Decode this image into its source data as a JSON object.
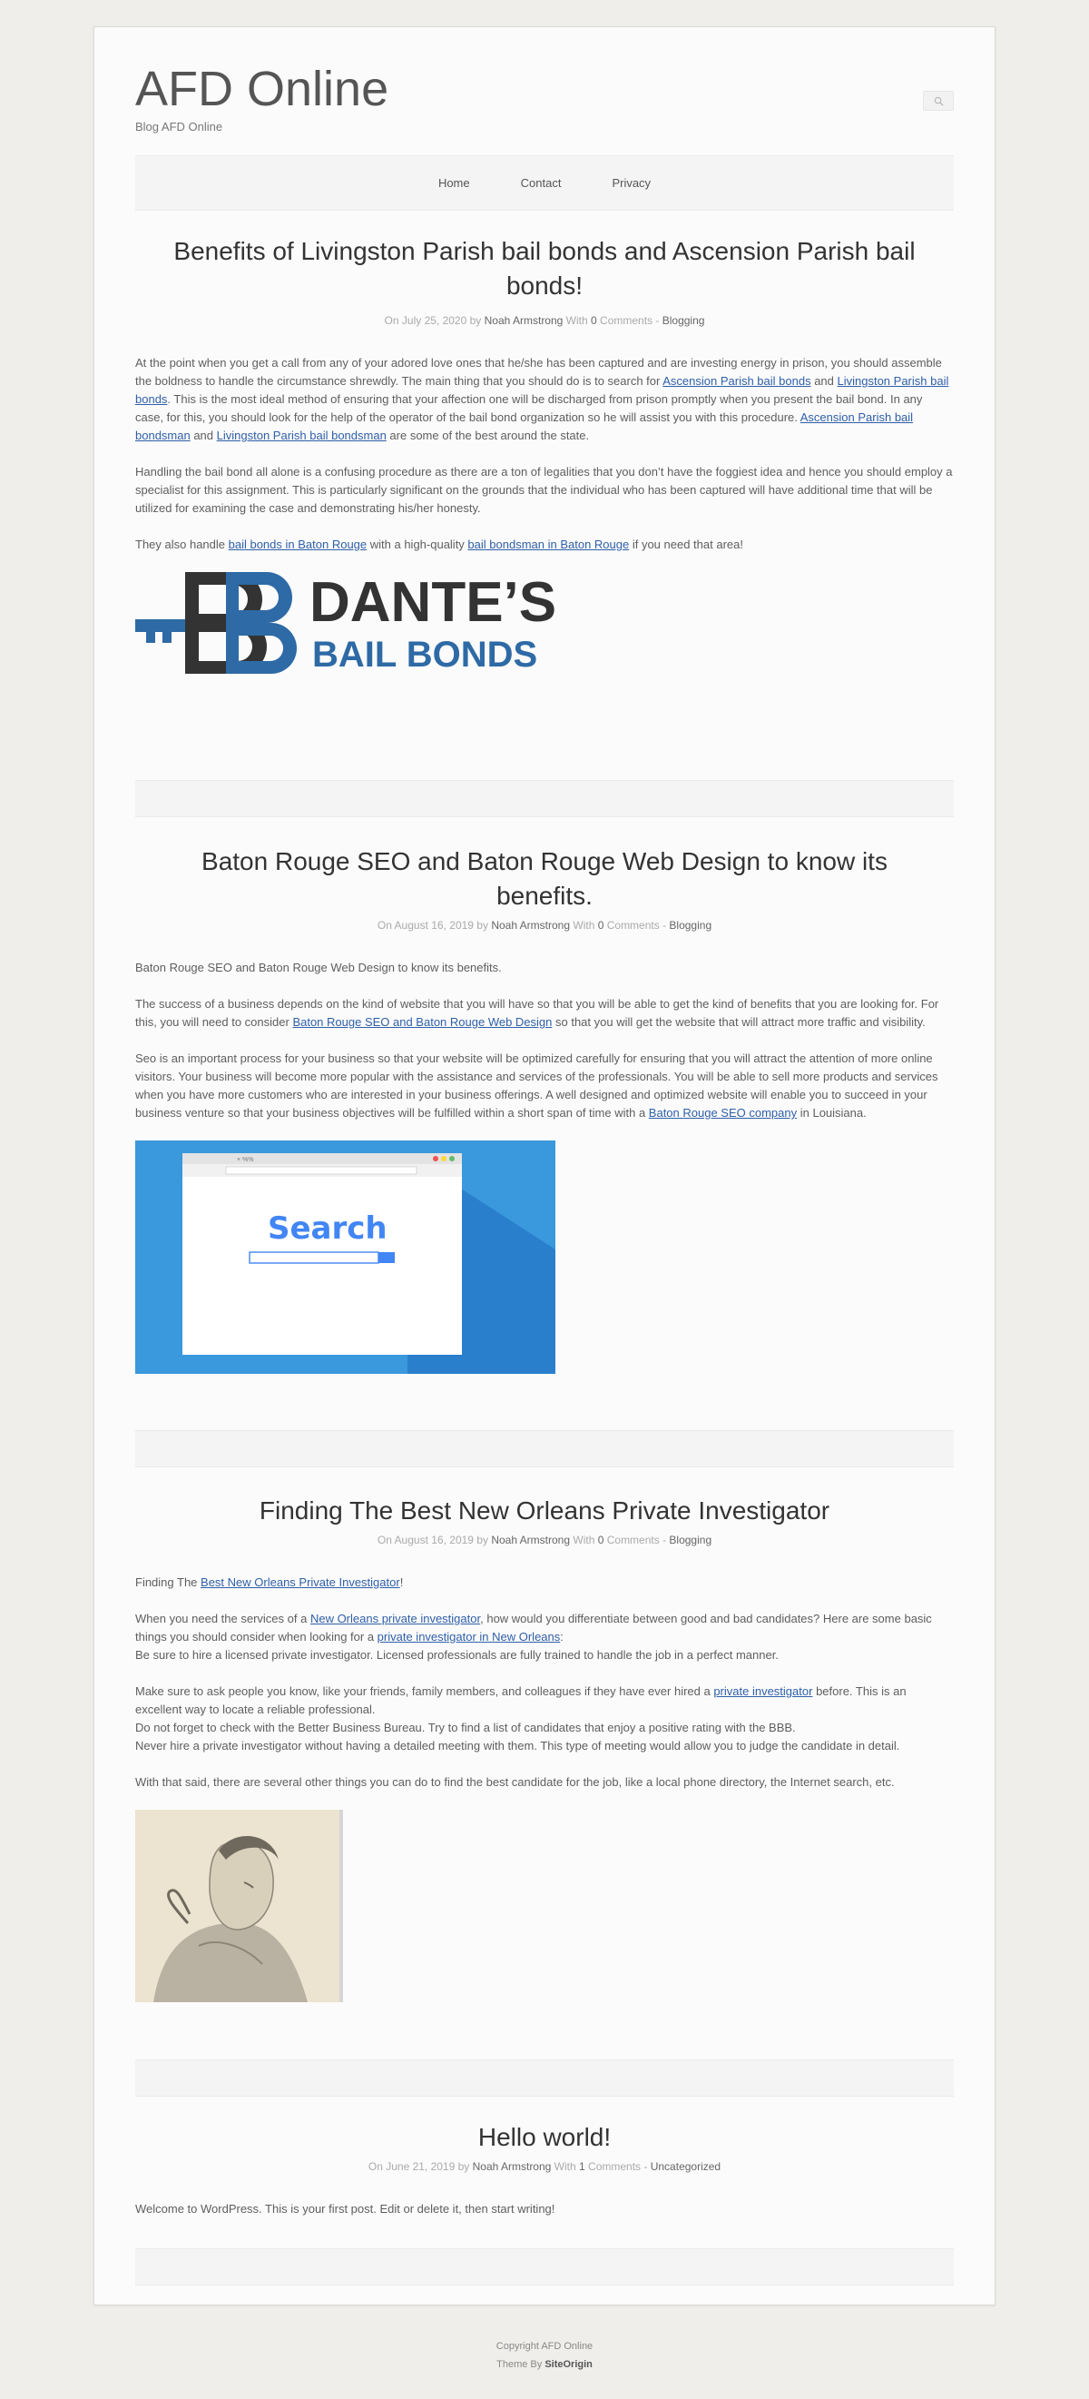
{
  "site": {
    "title": "AFD Online",
    "description": "Blog AFD Online"
  },
  "nav": {
    "items": [
      {
        "label": "Home"
      },
      {
        "label": "Contact"
      },
      {
        "label": "Privacy"
      }
    ]
  },
  "posts": [
    {
      "title": "Benefits of Livingston Parish bail bonds and Ascension Parish bail bonds!",
      "meta": {
        "date_prefix": "On July 25, 2020 by ",
        "author": "Noah Armstrong",
        "with": " With ",
        "comments": "0",
        "comments_suffix": " Comments - ",
        "category": "Blogging"
      },
      "p1": {
        "t1": "At the point when you get a call from any of your adored love ones that he/she has been captured and are investing energy in prison, you should assemble the boldness to handle the circumstance shrewdly. The main thing that you should do is to search for ",
        "l1": "Ascension Parish bail bonds",
        "t2": " and ",
        "l2": "Livingston Parish bail bonds",
        "t3": ". This is the most ideal method of ensuring that your affection one will be discharged from prison promptly when you present the bail bond. In any case, for this, you should look for the help of the operator of the bail bond organization so he will assist you with this procedure. ",
        "l3": "Ascension Parish bail bondsman",
        "t4": " and ",
        "l4": "Livingston Parish bail bondsman",
        "t5": " are some of the best around the state."
      },
      "p2": "Handling the bail bond all alone is a confusing procedure as there are a ton of legalities that you don’t have the foggiest idea and hence you should employ a specialist for this assignment. This is particularly significant on the grounds that the individual who has been captured will have additional time that will be utilized for examining the case and demonstrating his/her honesty.",
      "p3": {
        "t1": "They also handle ",
        "l1": "bail bonds in Baton Rouge",
        "t2": " with a high-quality ",
        "l2": "bail bondsman in Baton Rouge",
        "t3": " if you need that area!"
      },
      "logo": {
        "line1": "DANTE’S",
        "line2": "BAIL BONDS",
        "mark": "DB",
        "color_dark": "#333333",
        "color_blue": "#2e6aa5"
      }
    },
    {
      "title": "Baton Rouge SEO and Baton Rouge Web Design to know its benefits.",
      "meta": {
        "date_prefix": "On August 16, 2019 by ",
        "author": "Noah Armstrong",
        "with": " With ",
        "comments": "0",
        "comments_suffix": " Comments - ",
        "category": "Blogging"
      },
      "p1": "Baton Rouge SEO and Baton Rouge Web Design to know its benefits.",
      "p2": {
        "t1": "The success of a business depends on the kind of website that you will have so that you will be able to get the kind of benefits that you are looking for. For this, you will need to consider ",
        "l1": "Baton Rouge SEO and Baton Rouge Web Design",
        "t2": " so that you will get the website that will attract more traffic and visibility."
      },
      "p3": {
        "t1": "Seo is an important process for your business so that your website will be optimized carefully for ensuring that you will attract the attention of more online visitors. Your business will become more popular with the assistance and services of the professionals. You will be able to sell more products and services when you have more customers who are interested in your business offerings. A well designed and optimized website will enable you to succeed in your business venture so that your business objectives will be fulfilled within a short span of time with a ",
        "l1": "Baton Rouge SEO company",
        "t2": " in Louisiana."
      },
      "image": {
        "word": "Search",
        "tab": "× %%"
      }
    },
    {
      "title": "Finding The Best New Orleans Private Investigator",
      "meta": {
        "date_prefix": "On August 16, 2019 by ",
        "author": "Noah Armstrong",
        "with": " With ",
        "comments": "0",
        "comments_suffix": " Comments - ",
        "category": "Blogging"
      },
      "p1": {
        "t1": "Finding The ",
        "l1": "Best New Orleans Private Investigator",
        "t2": "!"
      },
      "p2": {
        "t1": "When you need the services of a ",
        "l1": "New Orleans private investigator",
        "t2": ", how would you differentiate between good and bad candidates? Here are some basic things you should consider when looking for a ",
        "l2": "private investigator in New Orleans",
        "t3": ":",
        "line2": "Be sure to hire a licensed private investigator. Licensed professionals are fully trained to handle the job in a perfect manner."
      },
      "p3": {
        "t1": "Make sure to ask people you know, like your friends, family members, and colleagues if they have ever hired a ",
        "l1": "private investigator",
        "t2": " before. This is an excellent way to locate a reliable professional.",
        "line2": "Do not forget to check with the Better Business Bureau. Try to find a list of candidates that enjoy a positive rating with the BBB.",
        "line3": "Never hire a private investigator without having a detailed meeting with them. This type of meeting would allow you to judge the candidate in detail."
      },
      "p4": "With that said, there are several other things you can do to find the best candidate for the job, like a local phone directory, the Internet search, etc."
    },
    {
      "title": "Hello world!",
      "meta": {
        "date_prefix": "On June 21, 2019 by ",
        "author": "Noah Armstrong",
        "with": " With ",
        "comments": "1",
        "comments_suffix": " Comments - ",
        "category": "Uncategorized"
      },
      "p1": "Welcome to WordPress. This is your first post. Edit or delete it, then start writing!"
    }
  ],
  "footer": {
    "copyright": "Copyright AFD Online",
    "theme_prefix": "Theme By ",
    "theme_brand": "SiteOrigin"
  }
}
